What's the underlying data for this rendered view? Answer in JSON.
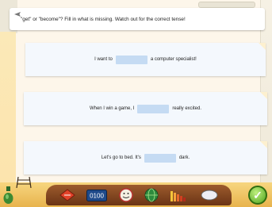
{
  "instruction": {
    "text": "\"get\" or \"become\"? Fill in what is missing. Watch out for the correct tense!"
  },
  "exercises": [
    {
      "before": "I want to",
      "answer": "",
      "after": "a computer specialist!"
    },
    {
      "before": "When I win a game, I",
      "answer": "",
      "after": "really excited."
    },
    {
      "before": "Let's go to bed. It's",
      "answer": "",
      "after": "dark."
    }
  ],
  "toolbar": {
    "counter_text": "0100",
    "tools": [
      "red-book-icon",
      "counter-display",
      "smiley-face-icon",
      "green-globe-icon",
      "bar-chart-icon",
      "speech-bubble-icon"
    ]
  },
  "colors": {
    "background": "#fdf6ea",
    "card": "#f4f8fd",
    "blank": "#c5dbf3",
    "toolbar": "#7a3e1b",
    "check": "#4ea21c"
  }
}
